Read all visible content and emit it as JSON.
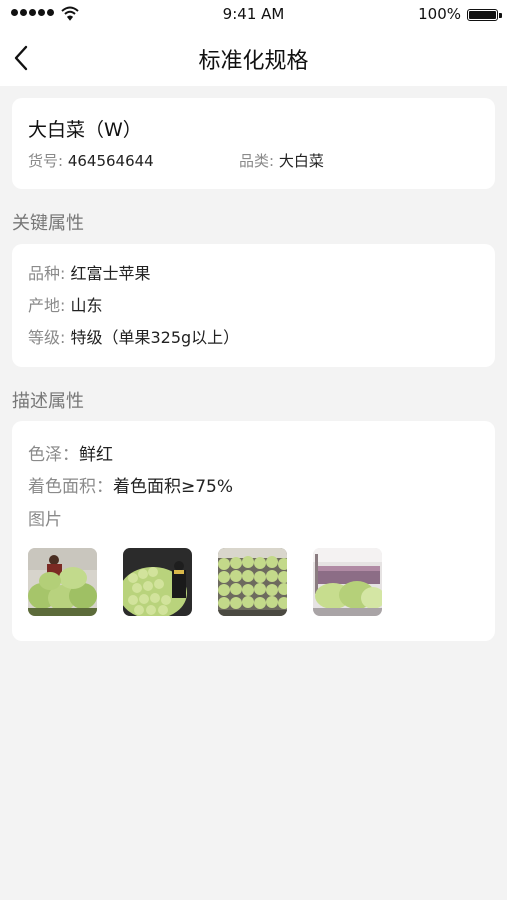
{
  "status_bar": {
    "time": "9:41 AM",
    "battery": "100%"
  },
  "nav": {
    "title": "标准化规格",
    "back_icon": "chevron-left-icon"
  },
  "product": {
    "name": "大白菜（W）",
    "sku_label": "货号: ",
    "sku_value": "464564644",
    "category_label": "品类: ",
    "category_value": "大白菜"
  },
  "key_attributes": {
    "title": "关键属性",
    "items": [
      {
        "label": "品种: ",
        "value": "红富士苹果"
      },
      {
        "label": "产地: ",
        "value": "山东"
      },
      {
        "label": "等级: ",
        "value": "特级（单果325g以上）"
      }
    ]
  },
  "desc_attributes": {
    "title": "描述属性",
    "items": [
      {
        "label": "色泽：",
        "value": "鲜红"
      },
      {
        "label": "着色面积：",
        "value": "着色面积≥75%"
      }
    ],
    "images_label": "图片"
  }
}
